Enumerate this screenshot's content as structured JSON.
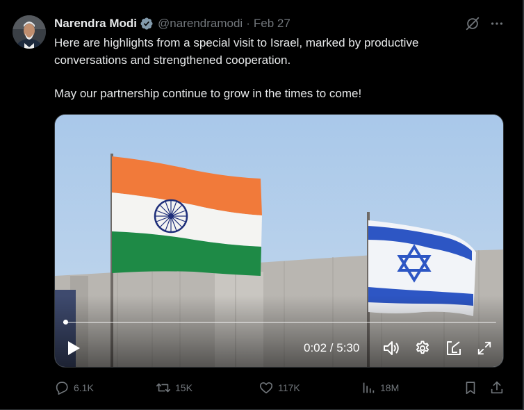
{
  "tweet": {
    "author_name": "Narendra Modi",
    "handle": "@narendramodi",
    "separator": "·",
    "date": "Feb 27",
    "text_line1": "Here are highlights from a special visit to Israel, marked by productive conversations and strengthened cooperation.",
    "text_line2": "May our partnership continue to grow in the times to come!"
  },
  "video": {
    "time_display": "0:02 / 5:30",
    "progress_fraction": 0.006
  },
  "actions": {
    "replies": "6.1K",
    "reposts": "15K",
    "likes": "117K",
    "views": "18M"
  },
  "icons": {
    "verified": "verified-badge-icon",
    "grok": "grok-icon",
    "more": "more-icon",
    "reply": "reply-icon",
    "repost": "repost-icon",
    "like": "heart-icon",
    "views": "views-icon",
    "bookmark": "bookmark-icon",
    "share": "share-icon",
    "play": "play-icon",
    "volume": "volume-icon",
    "settings": "settings-icon",
    "pip": "pip-icon",
    "fullscreen": "fullscreen-icon"
  },
  "colors": {
    "background": "#000000",
    "text": "#e7e9ea",
    "secondary": "#71767b",
    "verified": "#829aab"
  }
}
